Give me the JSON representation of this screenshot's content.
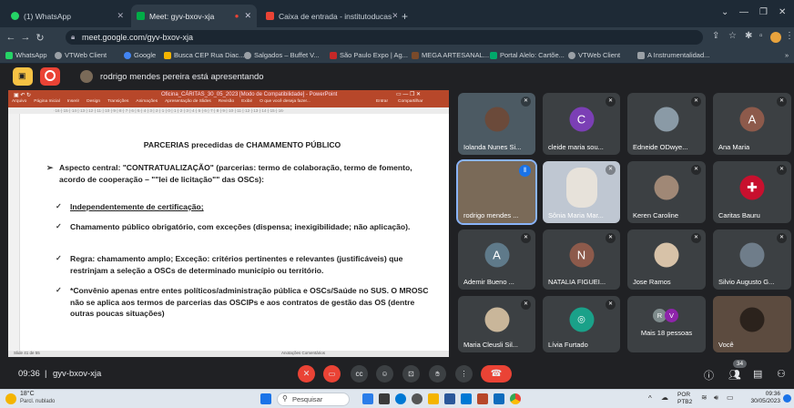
{
  "browser": {
    "tabs": [
      {
        "label": "(1) WhatsApp",
        "color": "#25d366"
      },
      {
        "label": "Meet: gyv-bxov-xja",
        "color": "#00ac47"
      },
      {
        "label": "Caixa de entrada - institutoducas",
        "color": "#ea4335"
      }
    ],
    "new_tab": "+",
    "url": "meet.google.com/gyv-bxov-xja",
    "bookmarks": [
      "WhatsApp",
      "VTWeb Client",
      "Google",
      "Busca CEP Rua Diac...",
      "Salgados – Buffet V...",
      "São Paulo Expo | Ag...",
      "MEGA ARTESANAL...",
      "Portal Alelo: Cartõe...",
      "VTWeb Client",
      "A Instrumentalidad..."
    ]
  },
  "meet": {
    "presenting_text": "rodrigo mendes pereira está apresentando",
    "time": "09:36",
    "code": "gyv-bxov-xja",
    "participants_badge": "34"
  },
  "ppt": {
    "title": "Oficina_CÁRITAS_30_05_2023 [Modo de Compatibilidade] - PowerPoint",
    "tabs": [
      "Arquivo",
      "Página Inicial",
      "Inserir",
      "Design",
      "Transições",
      "Animações",
      "Apresentação de Slides",
      "Revisão",
      "Exibir"
    ],
    "search": "O que você deseja fazer...",
    "account": "Entrar",
    "share": "Compartilhar",
    "status_left": "Slide 41 de 55",
    "status_right": "Anotações  Comentários"
  },
  "slide": {
    "title": "PARCERIAS precedidas de CHAMAMENTO PÚBLICO",
    "b1": "Aspecto central: \"CONTRATUALIZAÇÃO\" (parcerias: termo de colaboração, termo de fomento, acordo de cooperação – \"\"lei de licitação\"\" das OSCs):",
    "b2": "Independentemente de certificação;",
    "b3": "Chamamento público obrigatório, com exceções (dispensa; inexigibilidade; não aplicação).",
    "b4": "Regra: chamamento amplo; Exceção: critérios pertinentes e relevantes (justificáveis) que restrinjam a seleção a OSCs de determinado município ou território.",
    "b5": "*Convênio apenas entre entes políticos/administração pública e OSCs/Saúde no SUS. O MROSC não se aplica aos termos de parcerias das OSCIPs e aos contratos de gestão das OS (dentre outras poucas situações)"
  },
  "tiles": [
    {
      "name": "Iolanda Nunes Si...",
      "initial": "",
      "color": "#6b4a3a"
    },
    {
      "name": "cleide maria sou...",
      "initial": "C",
      "color": "#7b3fb5"
    },
    {
      "name": "Edneide ODwye...",
      "initial": "",
      "color": "#8a9aa6"
    },
    {
      "name": "Ana Maria",
      "initial": "A",
      "color": "#8d5a4b"
    },
    {
      "name": "rodrigo mendes ...",
      "initial": "",
      "color": "#7a6a58"
    },
    {
      "name": "Sônia Maria Mar...",
      "initial": "",
      "color": "#bfc7d2"
    },
    {
      "name": "Keren Caroline",
      "initial": "",
      "color": "#a08876"
    },
    {
      "name": "Caritas Bauru",
      "initial": "",
      "color": "#c8102e"
    },
    {
      "name": "Ademir Bueno ...",
      "initial": "A",
      "color": "#5f7a8a"
    },
    {
      "name": "NATALIA FIGUEI...",
      "initial": "N",
      "color": "#8d5a4b"
    },
    {
      "name": "Jose Ramos",
      "initial": "",
      "color": "#d7c2a8"
    },
    {
      "name": "Silvio Augusto G...",
      "initial": "",
      "color": "#6f7d8a"
    },
    {
      "name": "Maria Cleusli Sil...",
      "initial": "",
      "color": "#c9b69a"
    },
    {
      "name": "Lívia Furtado",
      "initial": "",
      "color": "#1aa189"
    },
    {
      "name": "Mais 18 pessoas",
      "initial": "",
      "color": "#3c4043"
    },
    {
      "name": "Você",
      "initial": "",
      "color": "#5c4b3f"
    }
  ],
  "more_people": {
    "a": "R",
    "b": "V"
  },
  "taskbar": {
    "weather_temp": "18°C",
    "weather_desc": "Parcl. nublado",
    "search": "Pesquisar",
    "lang": "POR",
    "lang2": "PTB2",
    "clock": "09:36",
    "date": "30/05/2023"
  }
}
